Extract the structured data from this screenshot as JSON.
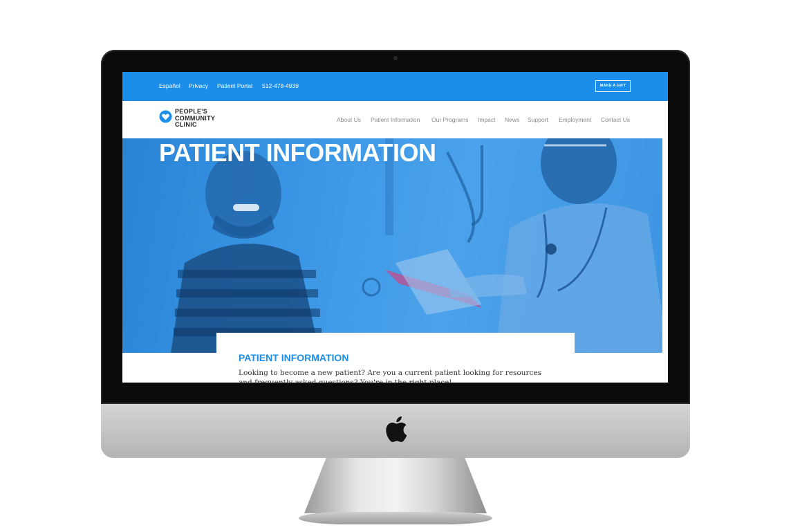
{
  "topbar": {
    "links": [
      "Español",
      "Privacy",
      "Patient Portal",
      "512-478-4939"
    ],
    "gift_button": "MAKE A GIFT"
  },
  "logo": {
    "line1": "PEOPLE'S",
    "line2": "COMMUNITY",
    "line3": "CLINIC",
    "icon": "heart-icon"
  },
  "nav": {
    "items": [
      "About Us",
      "Patient Information",
      "Our Programs",
      "Impact",
      "News",
      "Support",
      "Employment",
      "Contact Us"
    ]
  },
  "hero": {
    "title": "PATIENT INFORMATION"
  },
  "content": {
    "title": "PATIENT INFORMATION",
    "body": "Looking to become a new patient? Are you a current patient  looking for resources and frequently asked questions? You're in the right place!"
  },
  "colors": {
    "brand_blue": "#1a8eea",
    "hero_blue": "#3c97e6",
    "nav_text": "#8a8a8a"
  }
}
